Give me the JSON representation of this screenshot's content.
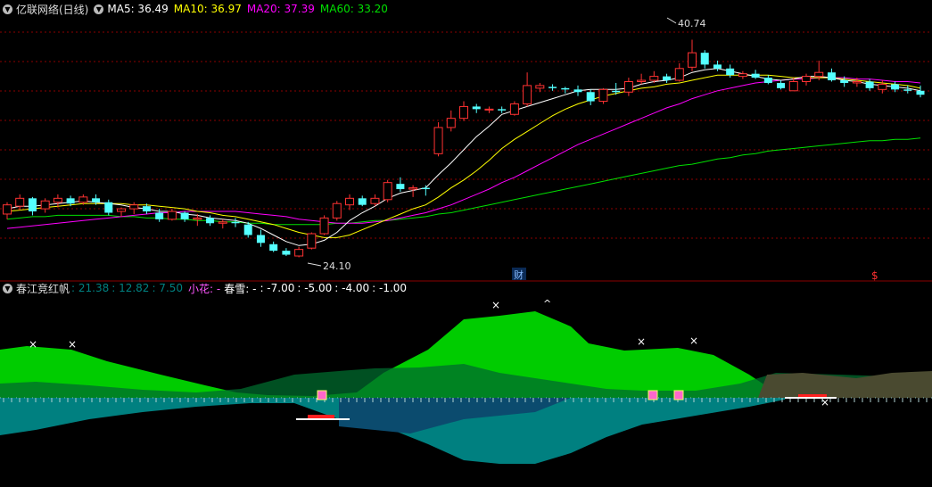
{
  "top_header": {
    "title": "亿联网络(日线)",
    "ma5": "MA5: 36.49",
    "ma10": "MA10: 36.97",
    "ma20": "MA20: 37.39",
    "ma60": "MA60: 33.20"
  },
  "bottom_header": {
    "title": "春江竞红帆",
    "v1": ": 21.38",
    "v2": ": 12.82",
    "v3": ": 7.50",
    "xiaohua": "小花: -",
    "chunxue": "春雪: -",
    "v4": ": -7.00",
    "v5": ": -5.00",
    "v6": ": -4.00",
    "v7": ": -1.00"
  },
  "markers": {
    "high_label": "40.74",
    "low_label": "24.10",
    "cai": "财",
    "dollar": "$"
  },
  "colors": {
    "up": "#ff3232",
    "down": "#54ffff",
    "ma5": "#ffffff",
    "ma10": "#ffff00",
    "ma20": "#ff00ff",
    "ma60": "#00e000",
    "grid": "#8b0000",
    "mountain": "#00cc00",
    "water": "#008080"
  },
  "chart_data": {
    "type": "candlestick",
    "title": "亿联网络(日线)",
    "ylim": [
      22.5,
      42.5
    ],
    "series_names": [
      "MA5",
      "MA10",
      "MA20",
      "MA60"
    ],
    "last_values": {
      "MA5": 36.49,
      "MA10": 36.97,
      "MA20": 37.39,
      "MA60": 33.2
    },
    "marked_high": 40.74,
    "marked_low": 24.1,
    "candles": [
      [
        27.4,
        28.3,
        27.0,
        28.1
      ],
      [
        28.0,
        28.9,
        27.7,
        28.6
      ],
      [
        28.6,
        28.7,
        27.3,
        27.6
      ],
      [
        27.8,
        28.6,
        27.5,
        28.4
      ],
      [
        28.3,
        28.9,
        27.9,
        28.6
      ],
      [
        28.6,
        28.8,
        28.0,
        28.2
      ],
      [
        28.3,
        28.9,
        28.1,
        28.7
      ],
      [
        28.6,
        28.9,
        28.1,
        28.3
      ],
      [
        28.3,
        28.5,
        27.3,
        27.5
      ],
      [
        27.6,
        27.9,
        27.2,
        27.8
      ],
      [
        27.8,
        28.3,
        27.4,
        28.1
      ],
      [
        28.0,
        28.2,
        27.4,
        27.6
      ],
      [
        27.5,
        27.8,
        26.8,
        27.0
      ],
      [
        27.0,
        27.8,
        26.9,
        27.6
      ],
      [
        27.5,
        27.6,
        26.8,
        27.0
      ],
      [
        27.0,
        27.4,
        26.5,
        27.1
      ],
      [
        27.1,
        27.3,
        26.5,
        26.7
      ],
      [
        26.7,
        27.0,
        26.3,
        26.8
      ],
      [
        26.8,
        27.1,
        26.4,
        26.7
      ],
      [
        26.6,
        26.8,
        25.6,
        25.8
      ],
      [
        25.8,
        26.2,
        24.9,
        25.2
      ],
      [
        25.1,
        25.3,
        24.5,
        24.6
      ],
      [
        24.6,
        24.8,
        24.2,
        24.3
      ],
      [
        24.2,
        24.9,
        24.1,
        24.7
      ],
      [
        24.8,
        26.0,
        24.7,
        25.9
      ],
      [
        25.9,
        27.3,
        25.8,
        27.1
      ],
      [
        27.1,
        28.4,
        26.9,
        28.2
      ],
      [
        28.1,
        28.9,
        27.7,
        28.6
      ],
      [
        28.6,
        28.8,
        28.0,
        28.1
      ],
      [
        28.2,
        28.9,
        28.0,
        28.6
      ],
      [
        28.5,
        30.0,
        28.3,
        29.8
      ],
      [
        29.7,
        30.2,
        29.1,
        29.3
      ],
      [
        29.3,
        29.6,
        28.7,
        29.4
      ],
      [
        29.4,
        29.6,
        28.8,
        29.3
      ],
      [
        32.0,
        34.4,
        31.8,
        34.0
      ],
      [
        34.0,
        35.3,
        33.7,
        34.7
      ],
      [
        34.7,
        36.0,
        34.5,
        35.6
      ],
      [
        35.6,
        35.8,
        35.1,
        35.4
      ],
      [
        35.4,
        35.6,
        35.1,
        35.4
      ],
      [
        35.4,
        35.6,
        35.1,
        35.3
      ],
      [
        35.0,
        36.0,
        34.9,
        35.8
      ],
      [
        35.8,
        38.2,
        35.6,
        37.2
      ],
      [
        37.0,
        37.4,
        36.7,
        37.2
      ],
      [
        37.1,
        37.3,
        36.8,
        37.0
      ],
      [
        37.0,
        37.1,
        36.6,
        36.9
      ],
      [
        36.9,
        37.2,
        36.4,
        36.7
      ],
      [
        36.7,
        36.9,
        35.7,
        36.0
      ],
      [
        36.0,
        37.0,
        35.8,
        36.9
      ],
      [
        36.8,
        37.4,
        36.5,
        36.7
      ],
      [
        36.7,
        37.8,
        36.4,
        37.5
      ],
      [
        37.5,
        38.1,
        37.3,
        37.6
      ],
      [
        37.6,
        38.3,
        37.4,
        37.9
      ],
      [
        37.9,
        38.1,
        37.4,
        37.6
      ],
      [
        37.6,
        38.9,
        37.5,
        38.5
      ],
      [
        38.6,
        40.7,
        38.3,
        39.7
      ],
      [
        39.7,
        39.9,
        38.5,
        38.8
      ],
      [
        38.8,
        39.1,
        38.3,
        38.5
      ],
      [
        38.5,
        38.8,
        37.8,
        38.0
      ],
      [
        37.9,
        38.3,
        37.7,
        38.1
      ],
      [
        38.1,
        38.4,
        37.7,
        37.8
      ],
      [
        37.8,
        38.0,
        37.3,
        37.4
      ],
      [
        37.4,
        37.6,
        36.9,
        37.0
      ],
      [
        36.8,
        37.8,
        36.8,
        37.5
      ],
      [
        37.5,
        38.1,
        37.2,
        37.9
      ],
      [
        37.9,
        39.1,
        37.6,
        38.2
      ],
      [
        38.2,
        38.5,
        37.5,
        37.6
      ],
      [
        37.6,
        37.9,
        37.1,
        37.4
      ],
      [
        37.4,
        37.8,
        37.1,
        37.5
      ],
      [
        37.5,
        37.7,
        36.8,
        37.0
      ],
      [
        36.9,
        37.6,
        36.6,
        37.3
      ],
      [
        37.3,
        37.5,
        36.7,
        36.9
      ],
      [
        36.9,
        37.2,
        36.6,
        36.8
      ],
      [
        36.8,
        37.2,
        36.3,
        36.5
      ]
    ],
    "ma5": [
      27.8,
      28.0,
      28.0,
      28.1,
      28.2,
      28.3,
      28.4,
      28.3,
      28.2,
      28.1,
      27.9,
      27.8,
      27.6,
      27.6,
      27.4,
      27.3,
      27.1,
      27.0,
      26.9,
      26.7,
      26.3,
      25.8,
      25.3,
      25.0,
      25.1,
      25.4,
      26.0,
      26.9,
      27.5,
      28.0,
      28.6,
      29.0,
      29.2,
      29.4,
      30.4,
      31.3,
      32.3,
      33.3,
      34.1,
      35.0,
      35.3,
      35.6,
      35.9,
      36.2,
      36.5,
      36.8,
      36.9,
      36.9,
      36.9,
      37.0,
      37.3,
      37.5,
      37.6,
      37.8,
      38.2,
      38.4,
      38.5,
      38.3,
      38.1,
      37.9,
      37.7,
      37.6,
      37.7,
      37.9,
      37.9,
      37.8,
      37.6,
      37.5,
      37.3,
      37.2,
      37.1,
      37.0,
      36.8
    ],
    "ma10": [
      27.6,
      27.7,
      27.8,
      27.9,
      28.0,
      28.1,
      28.2,
      28.2,
      28.2,
      28.2,
      28.1,
      28.1,
      28.0,
      27.9,
      27.8,
      27.6,
      27.5,
      27.3,
      27.2,
      27.0,
      26.8,
      26.6,
      26.3,
      26.0,
      25.8,
      25.6,
      25.6,
      25.8,
      26.2,
      26.6,
      27.0,
      27.4,
      27.8,
      28.1,
      28.7,
      29.4,
      30.0,
      30.7,
      31.5,
      32.4,
      33.1,
      33.7,
      34.3,
      34.9,
      35.4,
      35.8,
      36.1,
      36.4,
      36.6,
      36.8,
      37.0,
      37.1,
      37.3,
      37.4,
      37.6,
      37.8,
      38.0,
      38.0,
      38.0,
      38.0,
      38.0,
      37.9,
      37.8,
      37.8,
      37.8,
      37.8,
      37.7,
      37.6,
      37.5,
      37.4,
      37.3,
      37.2,
      37.0
    ],
    "ma20": [
      26.3,
      26.4,
      26.5,
      26.6,
      26.7,
      26.8,
      26.9,
      27.0,
      27.1,
      27.2,
      27.3,
      27.4,
      27.5,
      27.5,
      27.6,
      27.6,
      27.6,
      27.6,
      27.6,
      27.5,
      27.4,
      27.3,
      27.2,
      27.0,
      26.9,
      26.8,
      26.7,
      26.7,
      26.7,
      26.8,
      26.9,
      27.1,
      27.3,
      27.5,
      27.8,
      28.1,
      28.5,
      28.9,
      29.3,
      29.8,
      30.2,
      30.7,
      31.2,
      31.7,
      32.2,
      32.7,
      33.1,
      33.5,
      33.9,
      34.3,
      34.7,
      35.1,
      35.5,
      35.8,
      36.2,
      36.5,
      36.8,
      37.0,
      37.2,
      37.4,
      37.5,
      37.6,
      37.7,
      37.7,
      37.8,
      37.8,
      37.8,
      37.7,
      37.7,
      37.6,
      37.5,
      37.5,
      37.4
    ],
    "ma60": [
      27.0,
      27.1,
      27.2,
      27.2,
      27.3,
      27.3,
      27.3,
      27.3,
      27.3,
      27.2,
      27.2,
      27.1,
      27.1,
      27.0,
      27.0,
      26.9,
      26.9,
      26.8,
      26.8,
      26.7,
      26.7,
      26.6,
      26.6,
      26.6,
      26.6,
      26.6,
      26.7,
      26.7,
      26.8,
      26.9,
      26.9,
      27.0,
      27.1,
      27.2,
      27.4,
      27.5,
      27.7,
      27.9,
      28.1,
      28.3,
      28.5,
      28.7,
      28.9,
      29.1,
      29.3,
      29.5,
      29.7,
      29.9,
      30.1,
      30.3,
      30.5,
      30.7,
      30.9,
      31.1,
      31.2,
      31.4,
      31.6,
      31.7,
      31.9,
      32.0,
      32.2,
      32.3,
      32.4,
      32.5,
      32.6,
      32.7,
      32.8,
      32.9,
      33.0,
      33.0,
      33.1,
      33.1,
      33.2
    ]
  }
}
